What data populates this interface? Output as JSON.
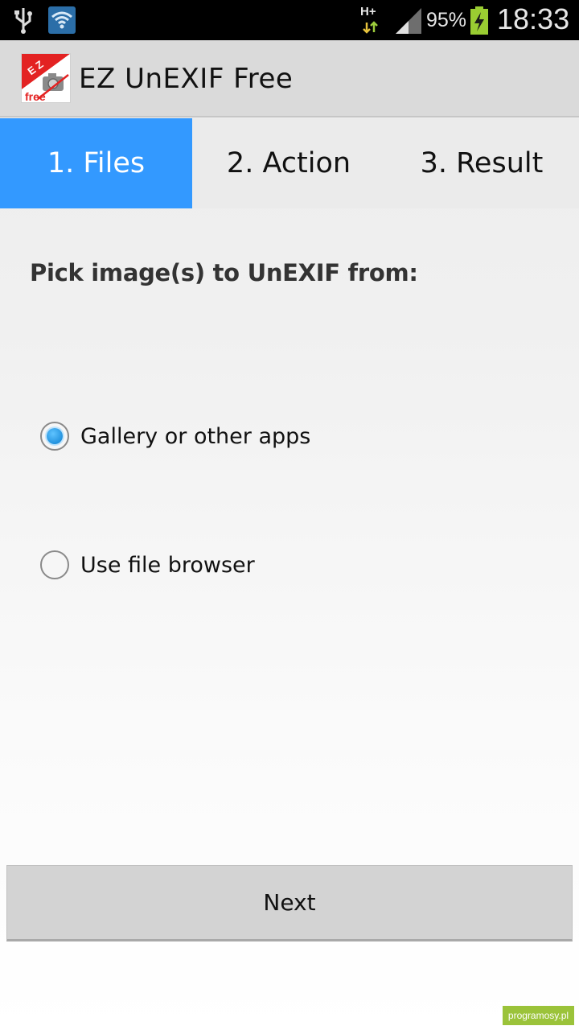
{
  "status_bar": {
    "network": "H+",
    "battery_percent": "95%",
    "time": "18:33",
    "icons": [
      "usb-icon",
      "wifi-icon",
      "data-arrows-icon",
      "signal-icon",
      "battery-charging-icon"
    ]
  },
  "action_bar": {
    "title": "EZ UnEXIF Free",
    "app_icon": "ez-unexif-logo-icon"
  },
  "tabs": [
    {
      "label": "1. Files",
      "active": true
    },
    {
      "label": "2. Action",
      "active": false
    },
    {
      "label": "3. Result",
      "active": false
    }
  ],
  "main": {
    "prompt": "Pick image(s) to UnEXIF from:",
    "options": [
      {
        "label": "Gallery or other apps",
        "checked": true
      },
      {
        "label": "Use file browser",
        "checked": false
      }
    ],
    "next_label": "Next"
  },
  "watermark": "programosy.pl",
  "colors": {
    "accent": "#3399ff",
    "status_bar": "#000000",
    "action_bar": "#dadada",
    "button": "#d3d3d3"
  }
}
